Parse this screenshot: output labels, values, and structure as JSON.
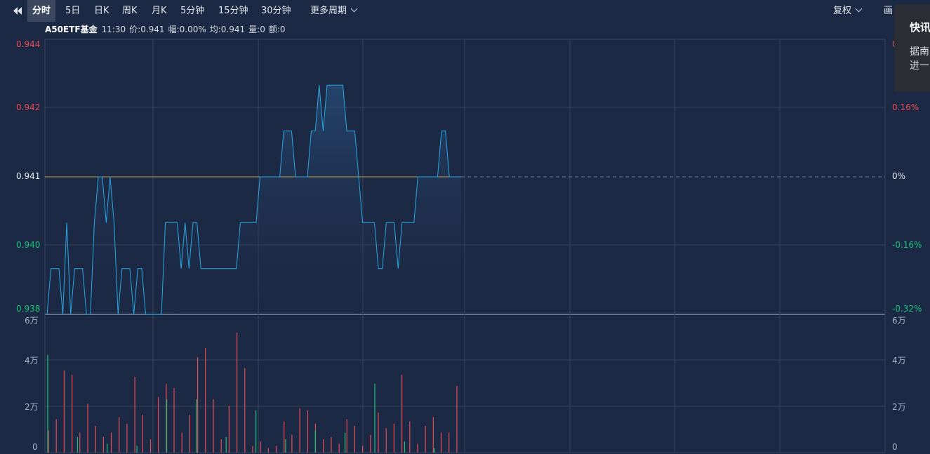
{
  "toolbar": {
    "items": [
      "分时",
      "5日",
      "日K",
      "周K",
      "月K",
      "5分钟",
      "15分钟",
      "30分钟",
      "更多周期"
    ],
    "active_index": 0,
    "fuquan": "复权",
    "draw": "画"
  },
  "info": {
    "name": "A50ETF基金",
    "time": "11:30",
    "price": "价:0.941",
    "change": "幅:0.00%",
    "avg": "均:0.941",
    "volume": "量:0",
    "amount": "额:0"
  },
  "popup": {
    "title": "快讯",
    "text": "据南\n进一"
  },
  "axes": {
    "price_left": [
      "0.944",
      "0.942",
      "0.941",
      "0.940",
      "0.938"
    ],
    "pct_right": [
      "0",
      "0.16%",
      "0%",
      "-0.16%",
      "-0.32%"
    ],
    "vol_left": [
      "6万",
      "4万",
      "2万",
      "0"
    ],
    "vol_right": [
      "6万",
      "4万",
      "2万",
      "0"
    ]
  },
  "colors": {
    "up": "#e74c55",
    "down": "#19c37a",
    "price_line": "#2aa8e6",
    "avg_line": "#c8a040",
    "grid": "#33425c"
  },
  "chart_data": {
    "type": "line",
    "price_range": [
      0.938,
      0.944
    ],
    "prev_close": 0.941,
    "volume_range": [
      0,
      60000
    ],
    "price": [
      0.938,
      0.939,
      0.939,
      0.939,
      0.938,
      0.94,
      0.938,
      0.939,
      0.939,
      0.939,
      0.938,
      0.938,
      0.94,
      0.941,
      0.941,
      0.94,
      0.941,
      0.94,
      0.938,
      0.939,
      0.939,
      0.939,
      0.938,
      0.939,
      0.939,
      0.938,
      0.938,
      0.938,
      0.938,
      0.938,
      0.94,
      0.94,
      0.94,
      0.94,
      0.939,
      0.94,
      0.939,
      0.94,
      0.94,
      0.939,
      0.939,
      0.939,
      0.939,
      0.939,
      0.939,
      0.939,
      0.939,
      0.939,
      0.939,
      0.94,
      0.94,
      0.94,
      0.94,
      0.94,
      0.941,
      0.941,
      0.941,
      0.941,
      0.941,
      0.941,
      0.942,
      0.942,
      0.942,
      0.941,
      0.941,
      0.941,
      0.941,
      0.942,
      0.942,
      0.943,
      0.942,
      0.943,
      0.943,
      0.943,
      0.943,
      0.943,
      0.942,
      0.942,
      0.942,
      0.941,
      0.94,
      0.94,
      0.94,
      0.94,
      0.939,
      0.939,
      0.94,
      0.94,
      0.94,
      0.939,
      0.94,
      0.94,
      0.94,
      0.94,
      0.941,
      0.941,
      0.941,
      0.941,
      0.941,
      0.941,
      0.942,
      0.942,
      0.941,
      0.941,
      0.941,
      0.941
    ],
    "avg": [
      0.941,
      0.941
    ],
    "volume_up": [
      10000,
      15000,
      37000,
      35000,
      9000,
      22000,
      12000,
      7000,
      9000,
      16000,
      13000,
      34000,
      17000,
      6000,
      25000,
      31000,
      29000,
      9000,
      17000,
      43000,
      47000,
      24000,
      6000,
      21000,
      54000,
      38000,
      3000,
      5000,
      2000,
      3000,
      14000,
      8000,
      20000,
      19000,
      13000,
      6000,
      7000,
      4000,
      15000,
      12000,
      3000,
      8000,
      18000,
      11000,
      13000,
      35000,
      14000,
      4000,
      12000,
      16000,
      9000,
      9000,
      30000
    ],
    "volume_down": [
      44000,
      7000,
      4000,
      3000,
      24000,
      24000,
      7000,
      19000,
      6000,
      10000,
      9000,
      31000,
      5000,
      2000
    ]
  }
}
